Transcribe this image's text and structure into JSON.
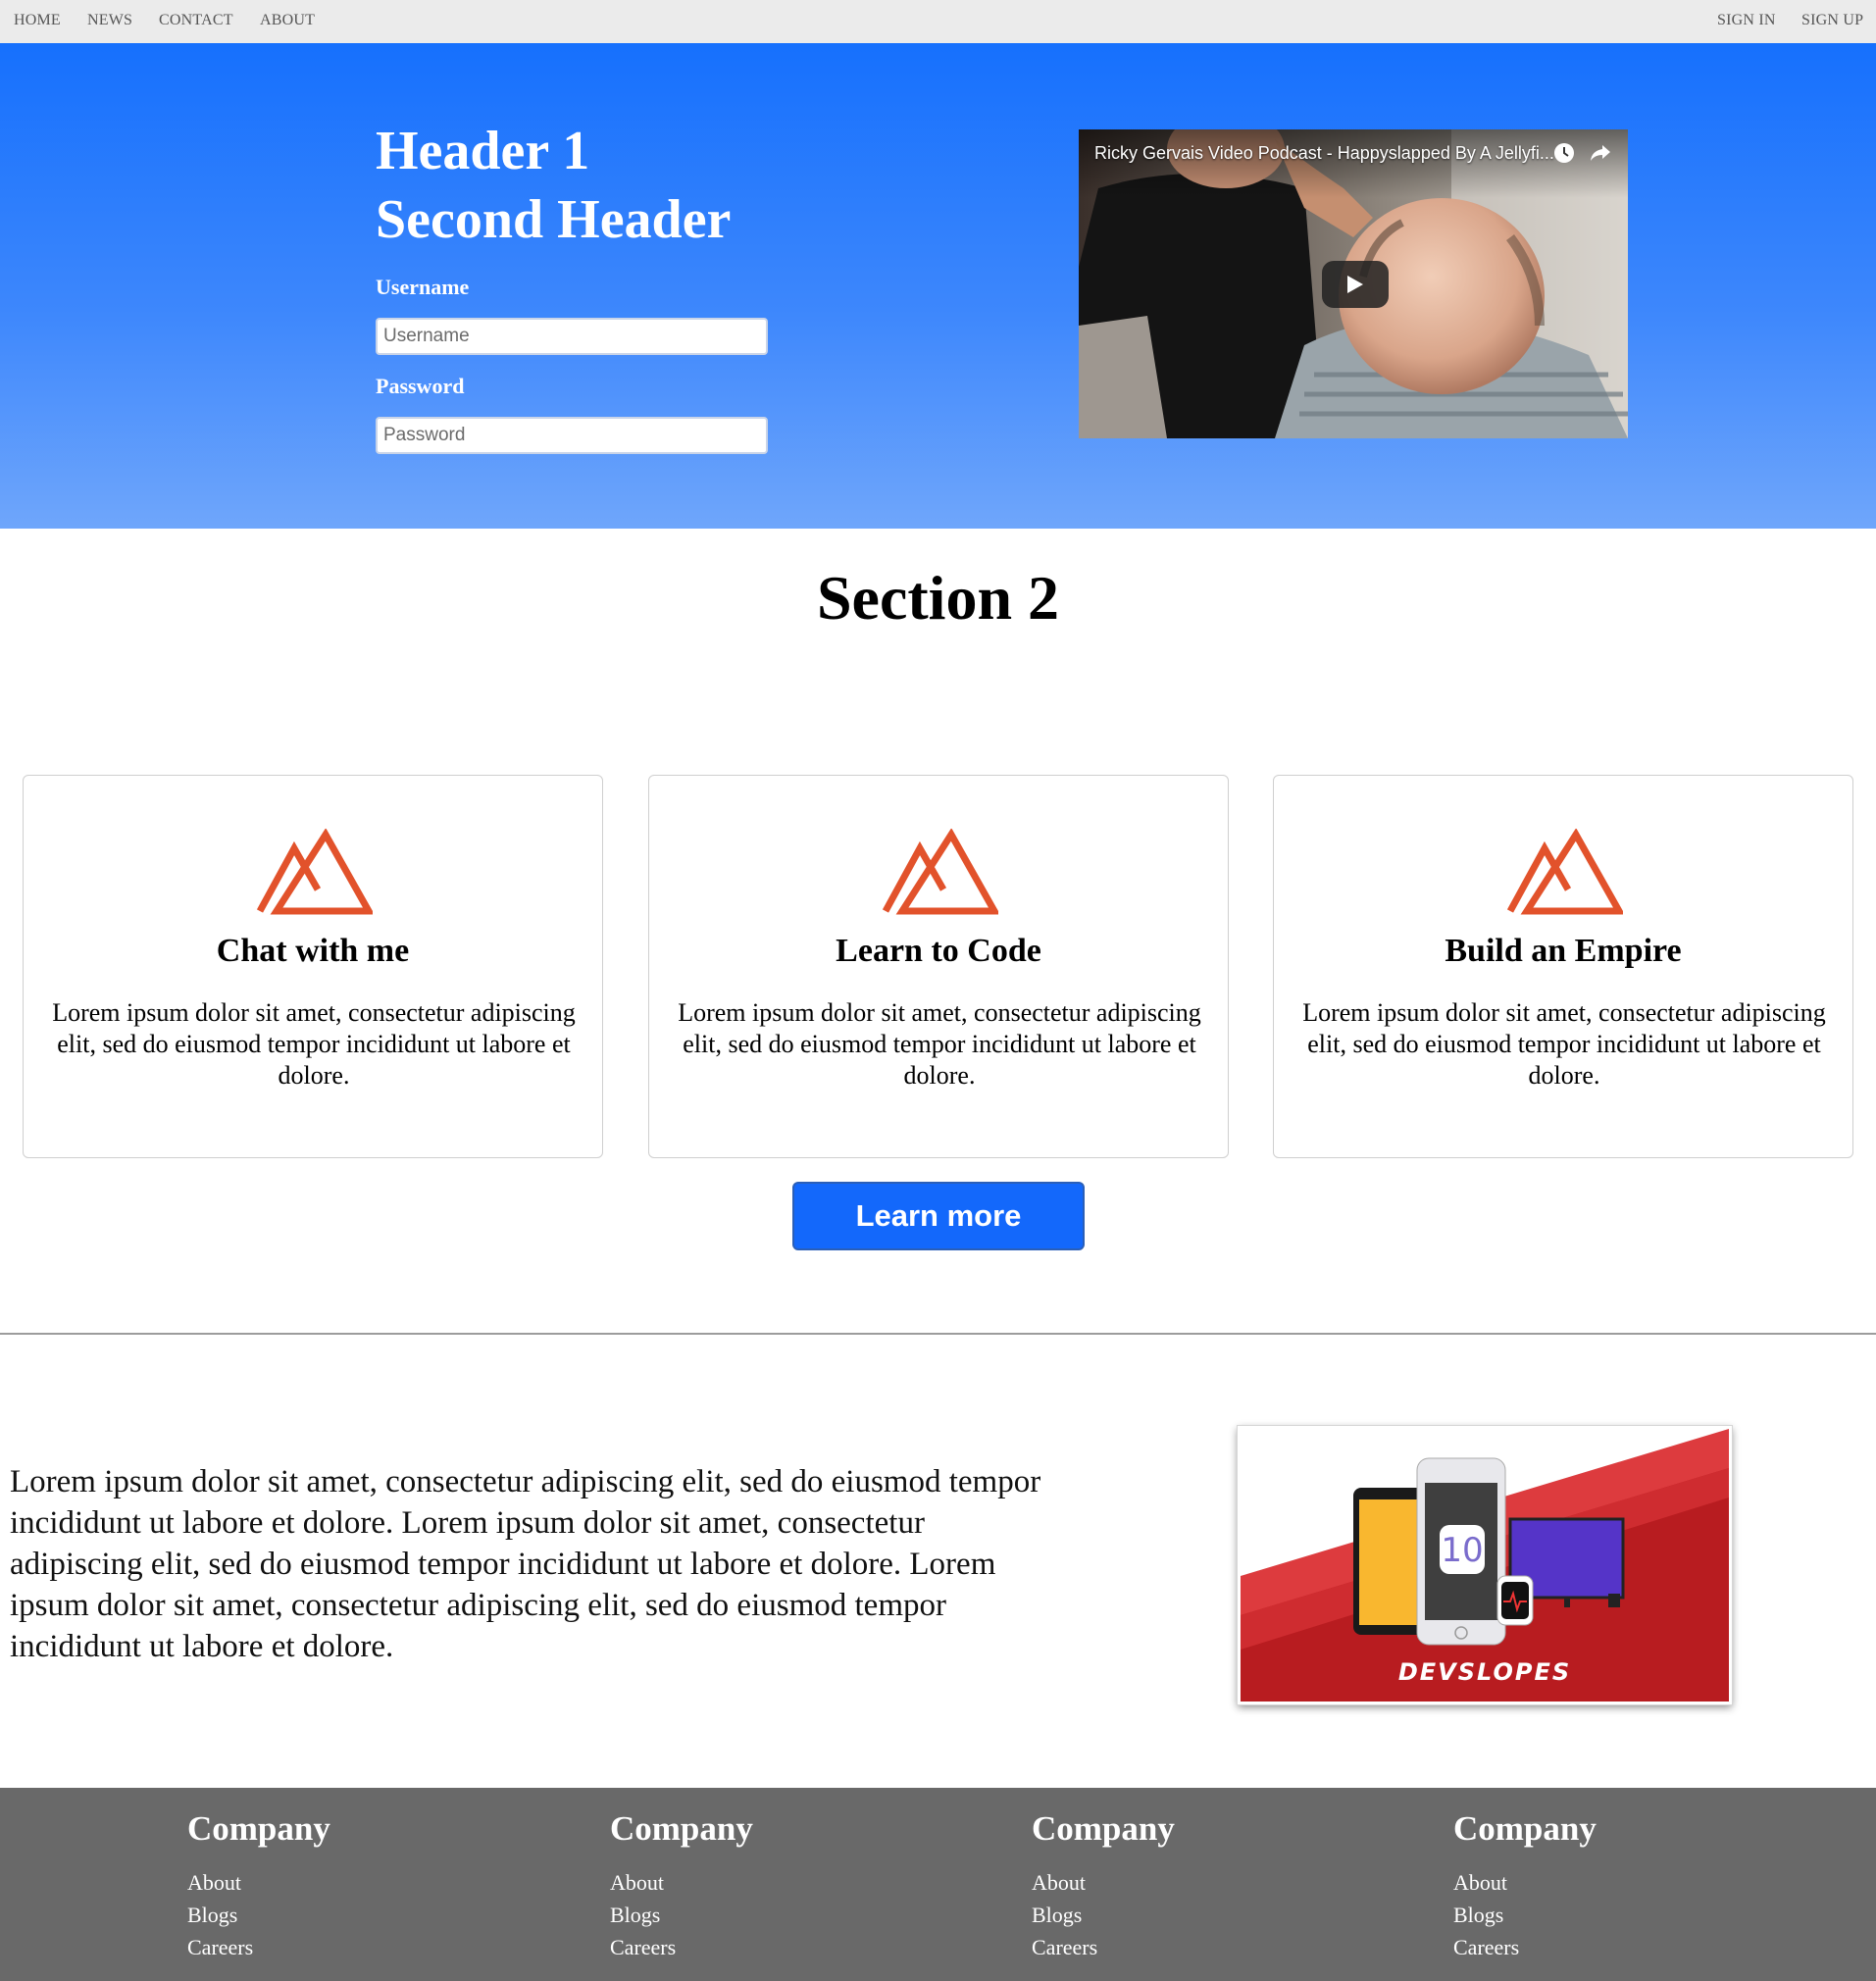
{
  "nav": {
    "left": [
      "HOME",
      "NEWS",
      "CONTACT",
      "ABOUT"
    ],
    "right": [
      "SIGN IN",
      "SIGN UP"
    ]
  },
  "hero": {
    "header1": "Header 1",
    "header2": "Second Header",
    "username_label": "Username",
    "username_placeholder": "Username",
    "password_label": "Password",
    "password_placeholder": "Password",
    "background_top": "#1670fd",
    "background_bottom": "#6fa6fb"
  },
  "video": {
    "title": "Ricky Gervais Video Podcast - Happyslapped By A Jellyfi...",
    "icons": [
      "clock-icon",
      "share-icon",
      "play-icon"
    ]
  },
  "section2": {
    "title": "Section 2",
    "cards": [
      {
        "icon": "mountain-icon",
        "title": "Chat with me",
        "text": "Lorem ipsum dolor sit amet, consectetur adipiscing elit, sed do eiusmod tempor incididunt ut labore et dolore."
      },
      {
        "icon": "mountain-icon",
        "title": "Learn to Code",
        "text": "Lorem ipsum dolor sit amet, consectetur adipiscing elit, sed do eiusmod tempor incididunt ut labore et dolore."
      },
      {
        "icon": "mountain-icon",
        "title": "Build an Empire",
        "text": "Lorem ipsum dolor sit amet, consectetur adipiscing elit, sed do eiusmod tempor incididunt ut labore et dolore."
      }
    ],
    "icon_color": "#e2522b",
    "button_label": "Learn more",
    "button_color": "#1368fb"
  },
  "section3": {
    "text": "Lorem ipsum dolor sit amet, consectetur adipiscing elit, sed do eiusmod tempor incididunt ut labore et dolore. Lorem ipsum dolor sit amet, consectetur adipiscing elit, sed do eiusmod tempor incididunt ut labore et dolore. Lorem ipsum dolor sit amet, consectetur adipiscing elit, sed do eiusmod tempor incididunt ut labore et dolore.",
    "image_logo": "DEVSLOPES",
    "image_screen_text": "10"
  },
  "footer": {
    "columns": [
      {
        "title": "Company",
        "links": [
          "About",
          "Blogs",
          "Careers"
        ]
      },
      {
        "title": "Company",
        "links": [
          "About",
          "Blogs",
          "Careers"
        ]
      },
      {
        "title": "Company",
        "links": [
          "About",
          "Blogs",
          "Careers"
        ]
      },
      {
        "title": "Company",
        "links": [
          "About",
          "Blogs",
          "Careers"
        ]
      }
    ],
    "background": "#696969"
  }
}
